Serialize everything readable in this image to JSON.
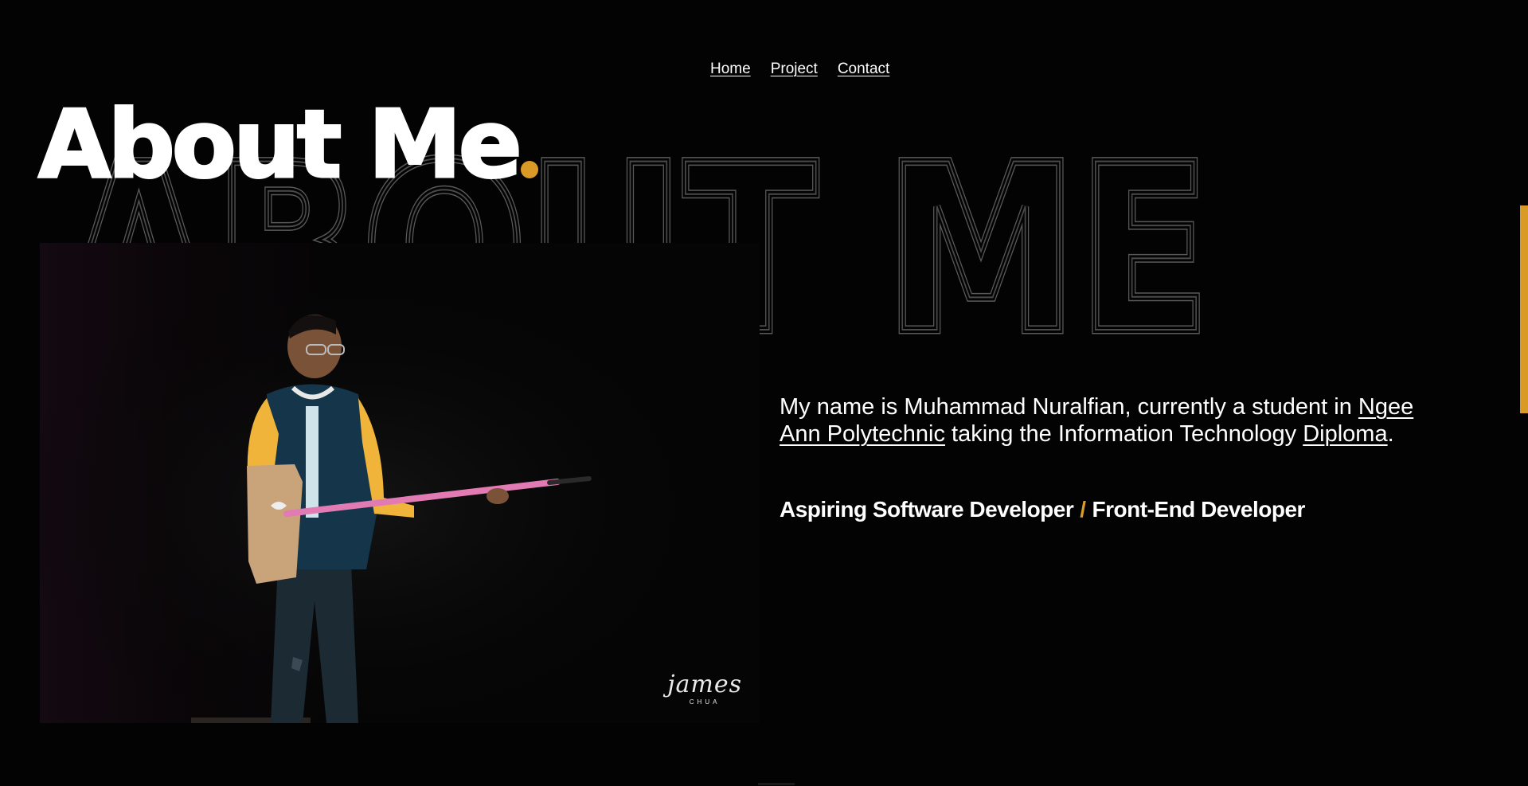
{
  "nav": {
    "items": [
      {
        "label": "Home"
      },
      {
        "label": "Project"
      },
      {
        "label": "Contact"
      }
    ]
  },
  "hero": {
    "title": "About Me",
    "backdrop_text": "ABOUT ME"
  },
  "photo": {
    "watermark_name": "james",
    "watermark_sub": "CHUA"
  },
  "about": {
    "intro_before_link": "My name is Muhammad Nuralfian, currently a student in ",
    "school_link": "Ngee Ann Polytechnic",
    "intro_middle": " taking the Information Technology ",
    "diploma_link": "Diploma",
    "intro_end": "."
  },
  "roles": {
    "primary": "Aspiring Software Developer",
    "separator": "/",
    "secondary": "Front-End Developer"
  },
  "colors": {
    "accent": "#d99b25",
    "background": "#030303",
    "text": "#ffffff",
    "outline": "#5a5a5a"
  }
}
